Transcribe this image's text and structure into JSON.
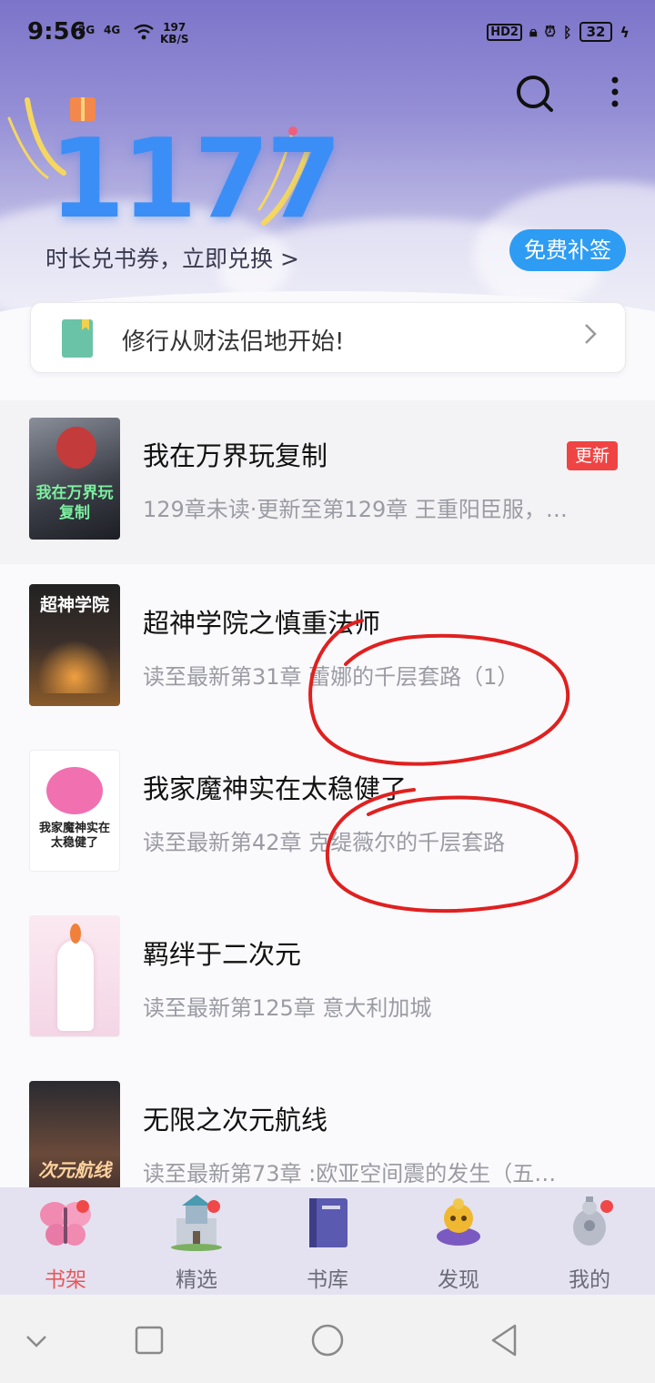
{
  "status": {
    "time": "9:56",
    "sig1": "2G",
    "sig2": "4G",
    "speed_value": "197",
    "speed_unit": "KB/S",
    "hd": "HD2",
    "battery": "32"
  },
  "header": {
    "counter": "1177",
    "exchange_text": "时长兑书券，立即兑换 >",
    "free_button": "免费补签"
  },
  "banner": {
    "text": "修行从财法侣地开始!"
  },
  "books": [
    {
      "title": "我在万界玩复制",
      "subtitle": "129章未读·更新至第129章 王重阳臣服，…",
      "badge": "更新",
      "cover_text": "我在万界玩复制"
    },
    {
      "title": "超神学院之慎重法师",
      "subtitle": "读至最新第31章 蕾娜的千层套路（1）",
      "cover_text": "超神学院"
    },
    {
      "title": "我家魔神实在太稳健了",
      "subtitle": "读至最新第42章 克缇薇尔的千层套路",
      "cover_text": "我家魔神实在太稳健了"
    },
    {
      "title": "羁绊于二次元",
      "subtitle": "读至最新第125章 意大利加城",
      "cover_text": ""
    },
    {
      "title": "无限之次元航线",
      "subtitle": "读至最新第73章 :欧亚空间震的发生（五…",
      "cover_text": "次元航线"
    }
  ],
  "tabs": [
    {
      "label": "书架",
      "icon": "butterfly-icon",
      "active": true
    },
    {
      "label": "精选",
      "icon": "castle-icon",
      "active": false
    },
    {
      "label": "书库",
      "icon": "book-icon",
      "active": false
    },
    {
      "label": "发现",
      "icon": "genie-lamp-icon",
      "active": false
    },
    {
      "label": "我的",
      "icon": "robot-icon",
      "active": false
    }
  ],
  "colors": {
    "accent_blue": "#2e9cf3",
    "counter_blue": "#3b8ef5",
    "badge_red": "#f04444",
    "active_tab": "#e7585a",
    "annotation_red": "#e02020"
  }
}
